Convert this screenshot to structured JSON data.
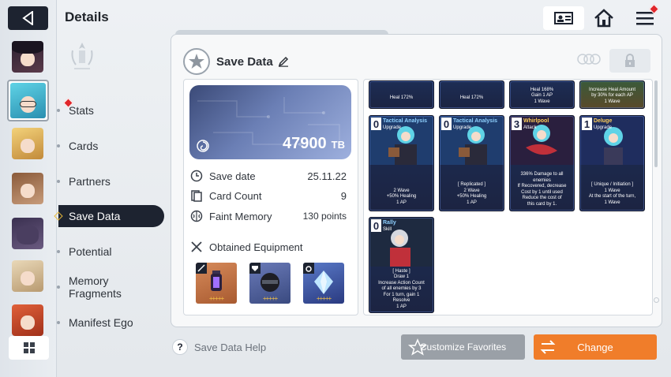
{
  "header": {
    "title": "Details",
    "back_icon": "back-arrow-icon",
    "profile_icon": "id-card-icon",
    "home_icon": "home-icon",
    "menu_icon": "hamburger-menu-icon"
  },
  "nav": {
    "items": [
      {
        "label": "Stats",
        "has_badge": true
      },
      {
        "label": "Cards"
      },
      {
        "label": "Partners"
      },
      {
        "label": "Save Data",
        "active": true
      },
      {
        "label": "Potential"
      },
      {
        "label": "Memory Fragments"
      },
      {
        "label": "Manifest Ego"
      }
    ]
  },
  "save_data": {
    "title": "Save Data",
    "tb_value": "47900",
    "tb_unit": "TB",
    "rows": [
      {
        "label": "Save date",
        "value": "25.11.22",
        "icon": "clock-icon"
      },
      {
        "label": "Card Count",
        "value": "9",
        "icon": "cards-icon"
      },
      {
        "label": "Faint Memory",
        "value": "130 points",
        "icon": "brain-icon"
      }
    ],
    "equipment_title": "Obtained Equipment",
    "equipment": [
      {
        "name": "lantern",
        "stars": "+++++",
        "tag_icon": "sword-icon"
      },
      {
        "name": "helmet",
        "stars": "+++++",
        "tag_icon": "armor-icon"
      },
      {
        "name": "crystal",
        "stars": "+++++",
        "tag_icon": "ring-icon"
      }
    ]
  },
  "deck": {
    "top_row": [
      {
        "desc": "Heal 172%"
      },
      {
        "desc": "Heal 172%"
      },
      {
        "desc": "Heal 168%\nGain 1 AP\n1 Wave"
      },
      {
        "desc": "Increase Heal Amount\nby 30% for each AP\n1 Wave"
      }
    ],
    "cards": [
      {
        "cost": "0",
        "name": "Tactical Analysis",
        "type": "Upgrade",
        "desc": "2 Wave\n+50% Healing\n1 AP",
        "name_color": "#8fd1ff"
      },
      {
        "cost": "0",
        "name": "Tactical Analysis",
        "type": "Upgrade",
        "desc": "[ Replicated ]\n2 Wave\n+50% Healing\n1 AP",
        "name_color": "#8fd1ff"
      },
      {
        "cost": "3",
        "name": "Whirlpool",
        "type": "Attack",
        "desc": "336% Damage to all\nenemies\nIf Recovered, decrease\nCost by 1 until used\nReduce the cost of\nthis card by 1.",
        "name_color": "#ffcf5a"
      },
      {
        "cost": "1",
        "name": "Deluge",
        "type": "Upgrade",
        "desc": "[ Unique / Initiation ]\n1 Wave\nAt the start of the turn,\n1 Wave",
        "name_color": "#ffcf5a"
      },
      {
        "cost": "0",
        "name": "Rally",
        "type": "Skill",
        "desc": "[ Haste ]\nDraw 1\nIncrease Action Count\nof all enemies by 3\nFor 1 turn, gain 1\nResolve\n1 AP",
        "name_color": "#8fd1ff"
      }
    ]
  },
  "footer": {
    "help_label": "Save Data Help",
    "favorites_label": "Customize Favorites",
    "change_label": "Change"
  },
  "colors": {
    "accent": "#f07d2a",
    "dark": "#1d2330",
    "badge": "#e0262b"
  }
}
